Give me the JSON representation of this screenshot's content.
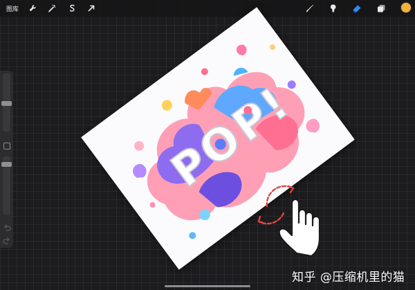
{
  "topbar": {
    "gallery_label": "图库",
    "left_tools": [
      "wrench-icon",
      "magic-wand-icon",
      "selection-s-icon",
      "transform-arrow-icon"
    ],
    "right_tools": [
      "brush-icon",
      "smudge-icon",
      "eraser-icon",
      "layers-icon",
      "color-icon"
    ],
    "active_tool": "eraser",
    "accent_color": "#2a8cff",
    "current_color": "#f0b23c"
  },
  "sidebar": {
    "controls": [
      "brush-size-slider",
      "modify-button",
      "opacity-slider",
      "undo-button",
      "redo-button"
    ]
  },
  "canvas": {
    "artwork_text": "POP!",
    "rotation_degrees": -36.5
  },
  "gesture": {
    "type": "two-finger rotate",
    "arrow_color": "#e0463c"
  },
  "watermark": "知乎 @压缩机里的猫"
}
